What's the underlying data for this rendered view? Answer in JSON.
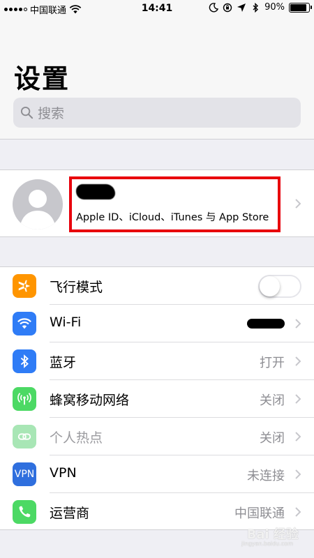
{
  "status_bar": {
    "carrier": "中国联通",
    "time": "14:41",
    "battery_percent": "90%",
    "battery_level": 0.9
  },
  "header": {
    "title": "设置",
    "search_placeholder": "搜索"
  },
  "profile": {
    "subtitle": "Apple ID、iCloud、iTunes 与 App Store"
  },
  "settings": [
    {
      "label": "飞行模式",
      "value": "",
      "icon": "airplane-icon",
      "color": "#ff9500",
      "toggle": false
    },
    {
      "label": "Wi-Fi",
      "value": "",
      "icon": "wifi-icon",
      "color": "#2f7cf6"
    },
    {
      "label": "蓝牙",
      "value": "打开",
      "icon": "bluetooth-icon",
      "color": "#2f7cf6"
    },
    {
      "label": "蜂窝移动网络",
      "value": "关闭",
      "icon": "cellular-icon",
      "color": "#4cd964"
    },
    {
      "label": "个人热点",
      "value": "关闭",
      "icon": "hotspot-icon",
      "color": "#a8e6b5"
    },
    {
      "label": "VPN",
      "value": "未连接",
      "icon": "vpn-icon",
      "color": "#2f6fde",
      "icon_text": "VPN"
    },
    {
      "label": "运营商",
      "value": "中国联通",
      "icon": "phone-icon",
      "color": "#4cd964"
    }
  ],
  "watermark": {
    "text": "Bai 经验",
    "url": "jingyan.baidu.com"
  }
}
